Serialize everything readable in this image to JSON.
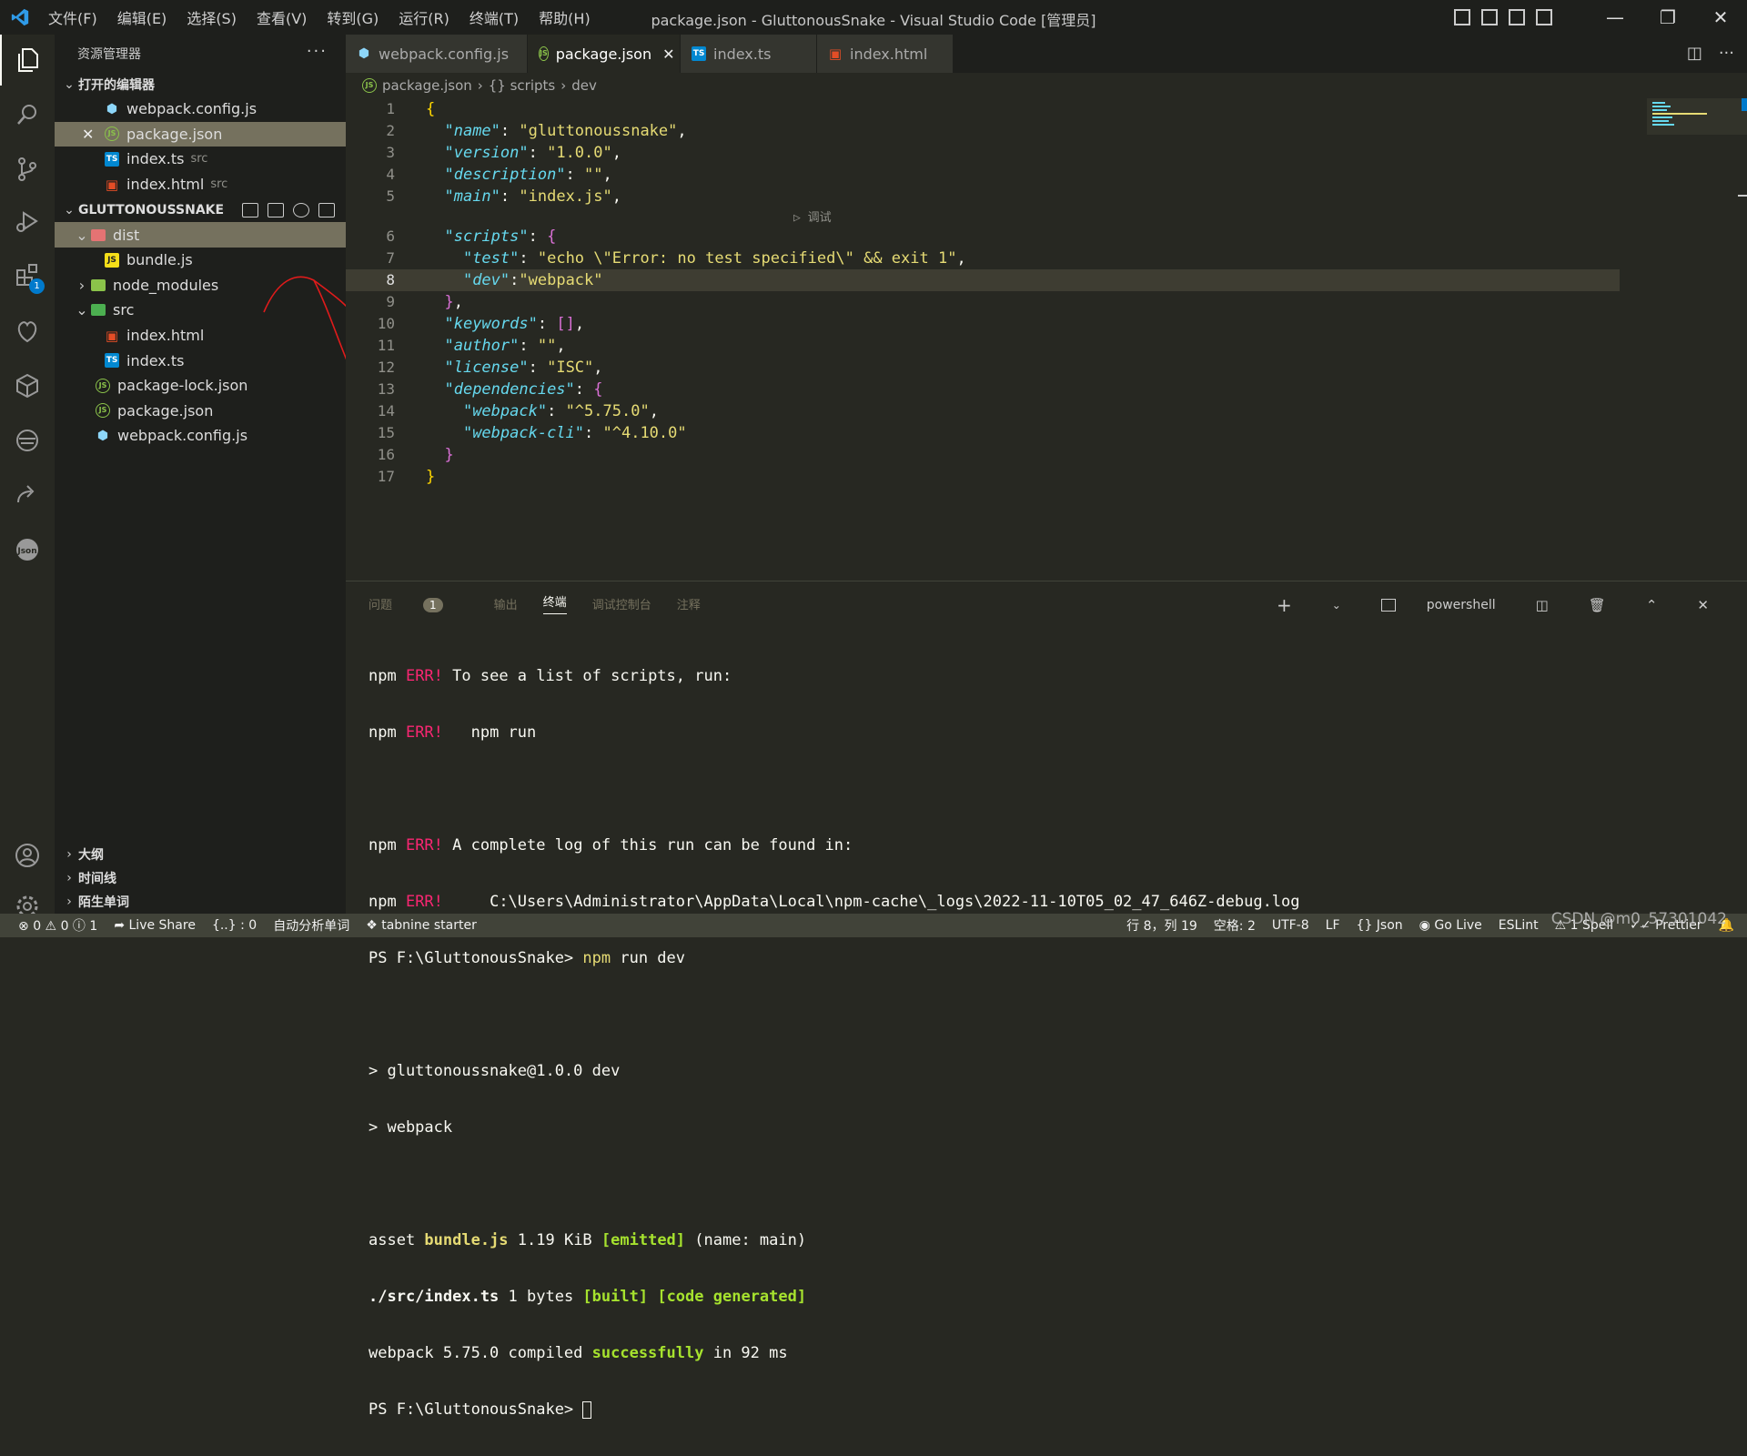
{
  "titlebar": {
    "menus": [
      "文件(F)",
      "编辑(E)",
      "选择(S)",
      "查看(V)",
      "转到(G)",
      "运行(R)",
      "终端(T)",
      "帮助(H)"
    ],
    "title": "package.json - GluttonousSnake - Visual Studio Code [管理员]"
  },
  "activity": {
    "extensions_badge": "1"
  },
  "sidebar": {
    "header": "资源管理器",
    "open_editors_label": "打开的编辑器",
    "open_editors": [
      {
        "name": "webpack.config.js",
        "desc": ""
      },
      {
        "name": "package.json",
        "desc": ""
      },
      {
        "name": "index.ts",
        "desc": "src"
      },
      {
        "name": "index.html",
        "desc": "src"
      }
    ],
    "project_label": "GLUTTONOUSSNAKE",
    "tree": [
      {
        "name": "dist"
      },
      {
        "name": "bundle.js"
      },
      {
        "name": "node_modules"
      },
      {
        "name": "src"
      },
      {
        "name": "index.html"
      },
      {
        "name": "index.ts"
      },
      {
        "name": "package-lock.json"
      },
      {
        "name": "package.json"
      },
      {
        "name": "webpack.config.js"
      }
    ],
    "bottom_sections": [
      "大纲",
      "时间线",
      "陌生单词"
    ]
  },
  "tabs": [
    "webpack.config.js",
    "package.json",
    "index.ts",
    "index.html"
  ],
  "breadcrumb": [
    "package.json",
    "{} scripts",
    "dev"
  ],
  "editor": {
    "codelens": "▷ 调试",
    "current_line": 8
  },
  "panel": {
    "tabs": [
      "问题",
      "输出",
      "终端",
      "调试控制台",
      "注释"
    ],
    "problems_count": "1",
    "shell": "powershell",
    "terminal": {
      "l1a": "npm ",
      "l1b": "ERR!",
      "l1c": " To see a list of scripts, run:",
      "l2a": "npm ",
      "l2b": "ERR!",
      "l2c": "   npm run",
      "l3a": "npm ",
      "l3b": "ERR!",
      "l3c": " A complete log of this run can be found in:",
      "l4a": "npm ",
      "l4b": "ERR!",
      "l4c": "     C:\\Users\\Administrator\\AppData\\Local\\npm-cache\\_logs\\2022-11-10T05_02_47_646Z-debug.log",
      "l5a": "PS F:\\GluttonousSnake> ",
      "l5b": "npm",
      "l5c": " run dev",
      "l6": "> gluttonoussnake@1.0.0 dev",
      "l7": "> webpack",
      "l8a": "asset ",
      "l8b": "bundle.js",
      "l8c": " 1.19 KiB ",
      "l8d": "[emitted]",
      "l8e": " (name: main)",
      "l9a": "./src/index.ts",
      "l9b": " 1 bytes ",
      "l9c": "[built]",
      "l9d": " ",
      "l9e": "[code generated]",
      "l10a": "webpack 5.75.0 compiled ",
      "l10b": "successfully",
      "l10c": " in 92 ms",
      "l11": "PS F:\\GluttonousSnake> "
    }
  },
  "statusbar": {
    "errors": "0",
    "warnings": "0",
    "info": "1",
    "live_share": "Live Share",
    "json_count": "{..} : 0",
    "auto_analyze": "自动分析单词",
    "tabnine": "tabnine starter",
    "position": "行 8，列 19",
    "spaces": "空格: 2",
    "encoding": "UTF-8",
    "eol": "LF",
    "language": "{} Json",
    "go_live": "Go Live",
    "eslint": "ESLint",
    "spell": "1 Spell",
    "prettier": "Prettier"
  },
  "watermark": "CSDN @m0_57301042",
  "colors": {
    "accent": "#007acc",
    "error": "#f92672",
    "string": "#e6db74",
    "key": "#66d9ef"
  }
}
